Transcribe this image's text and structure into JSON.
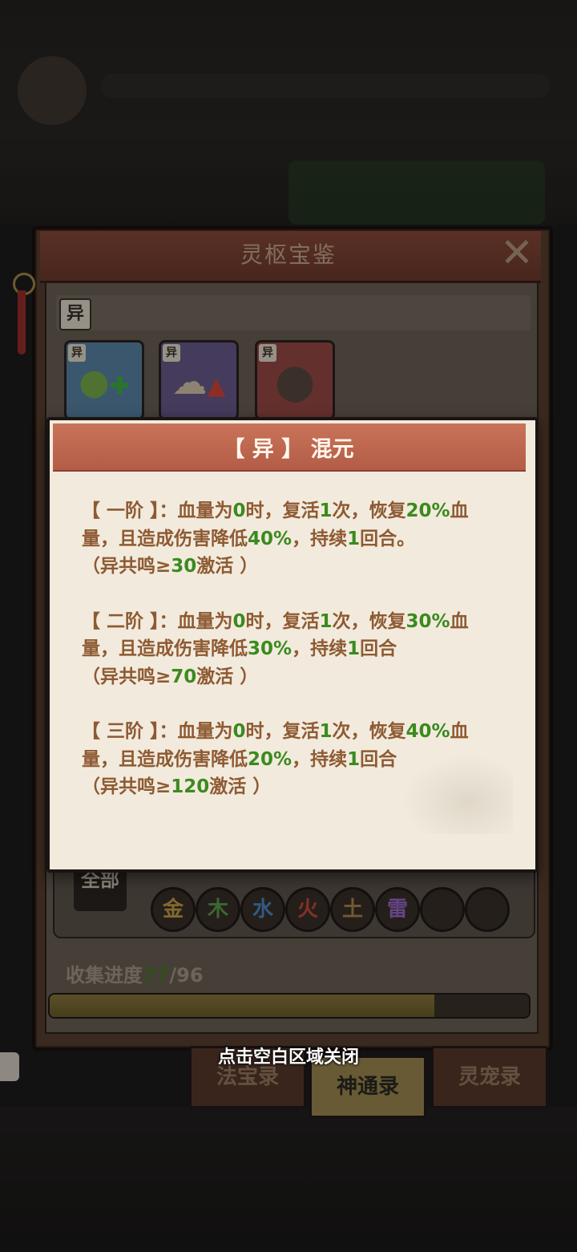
{
  "window": {
    "title": "灵枢宝鉴",
    "category_chip": "异"
  },
  "cards": [
    {
      "tag": "异",
      "icon": "coin-stack-plus-icon",
      "color": "#5b86a8"
    },
    {
      "tag": "异",
      "icon": "spirit-upgrade-icon",
      "color": "#6b5b8e"
    },
    {
      "tag": "异",
      "icon": "stone-orb-icon",
      "color": "#9a4a45"
    }
  ],
  "popup": {
    "title": "【 异 】 混元",
    "tiers": [
      {
        "head": "【 一阶 】：血量为",
        "zero": "0",
        "mid1": "时，复活",
        "n1": "1",
        "mid2": "次，恢复",
        "pct": "20%",
        "mid3": "血量，且造成伤害降低",
        "reduce": "40%",
        "mid4": "，持续",
        "turns": "1",
        "tail": "回合。",
        "cond_pre": "（异共鸣≥",
        "cond_val": "30",
        "cond_post": "激活 ）"
      },
      {
        "head": "【 二阶 】：血量为",
        "zero": "0",
        "mid1": "时，复活",
        "n1": "1",
        "mid2": "次，恢复",
        "pct": "30%",
        "mid3": "血量，且造成伤害降低",
        "reduce": "30%",
        "mid4": "，持续",
        "turns": "1",
        "tail": "回合",
        "cond_pre": "（异共鸣≥",
        "cond_val": "70",
        "cond_post": "激活 ）"
      },
      {
        "head": "【 三阶 】：血量为",
        "zero": "0",
        "mid1": "时，复活",
        "n1": "1",
        "mid2": "次，恢复",
        "pct": "40%",
        "mid3": "血量，且造成伤害降低",
        "reduce": "20%",
        "mid4": "，持续",
        "turns": "1",
        "tail": "回合",
        "cond_pre": "（异共鸣≥",
        "cond_val": "120",
        "cond_post": "激活 ）"
      }
    ]
  },
  "filters": {
    "all_label": "全部",
    "elements": [
      {
        "label": "金",
        "color": "#c9a24a"
      },
      {
        "label": "木",
        "color": "#5aa04a"
      },
      {
        "label": "水",
        "color": "#4a8ac9"
      },
      {
        "label": "火",
        "color": "#c94a3a"
      },
      {
        "label": "土",
        "color": "#b08a4a"
      },
      {
        "label": "雷",
        "color": "#9a6ac9"
      }
    ]
  },
  "progress": {
    "label": "收集进度",
    "current": "77",
    "separator": "/",
    "total": "96",
    "fraction": 0.802
  },
  "tabs": [
    {
      "label": "法宝录",
      "active": false
    },
    {
      "label": "神通录",
      "active": true
    },
    {
      "label": "灵宠录",
      "active": false
    }
  ],
  "close_hint": "点击空白区域关闭",
  "colors": {
    "highlight_green": "#3c8a1f",
    "body_text": "#8e5a33",
    "popup_header": "#b35d47"
  }
}
